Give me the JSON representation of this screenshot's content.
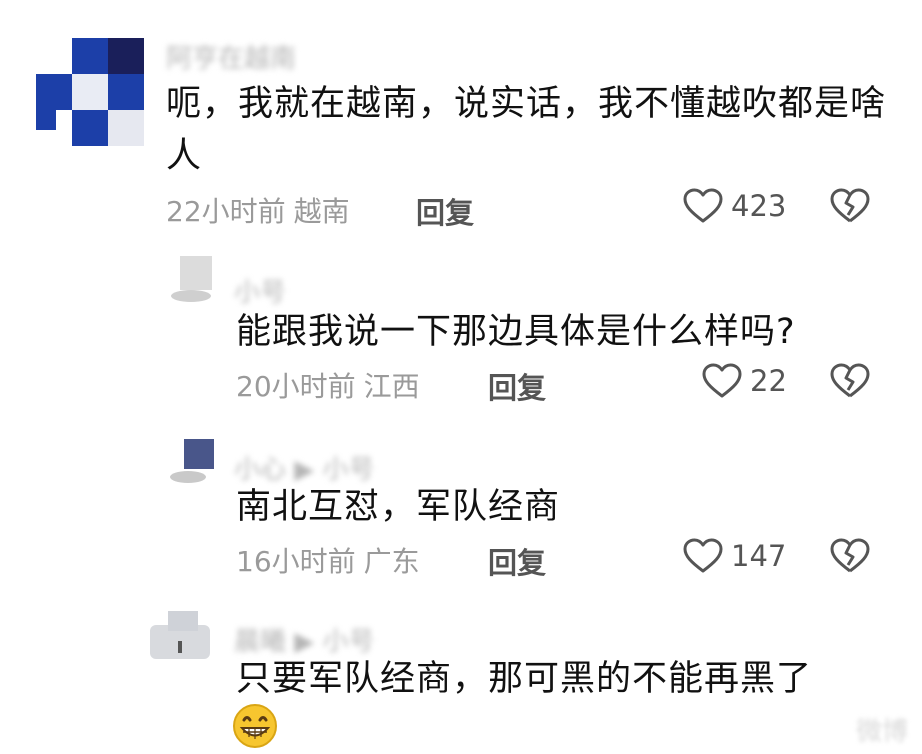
{
  "comments": [
    {
      "username": "阿亨在越南",
      "text": "呃，我就在越南，说实话，我不懂越吹都是啥人",
      "time": "22小时前",
      "location": "越南",
      "reply_label": "回复",
      "likes": "423"
    },
    {
      "username": "小号",
      "text": "能跟我说一下那边具体是什么样吗?",
      "time": "20小时前",
      "location": "江西",
      "reply_label": "回复",
      "likes": "22"
    },
    {
      "username": "小心 ▶ 小号",
      "text": "南北互怼，军队经商",
      "time": "16小时前",
      "location": "广东",
      "reply_label": "回复",
      "likes": "147"
    },
    {
      "username": "晨曦 ▶ 小号",
      "text": "只要军队经商，那可黑的不能再黑了",
      "emoji": "grinning-face-emoji"
    }
  ],
  "watermark": "微博"
}
